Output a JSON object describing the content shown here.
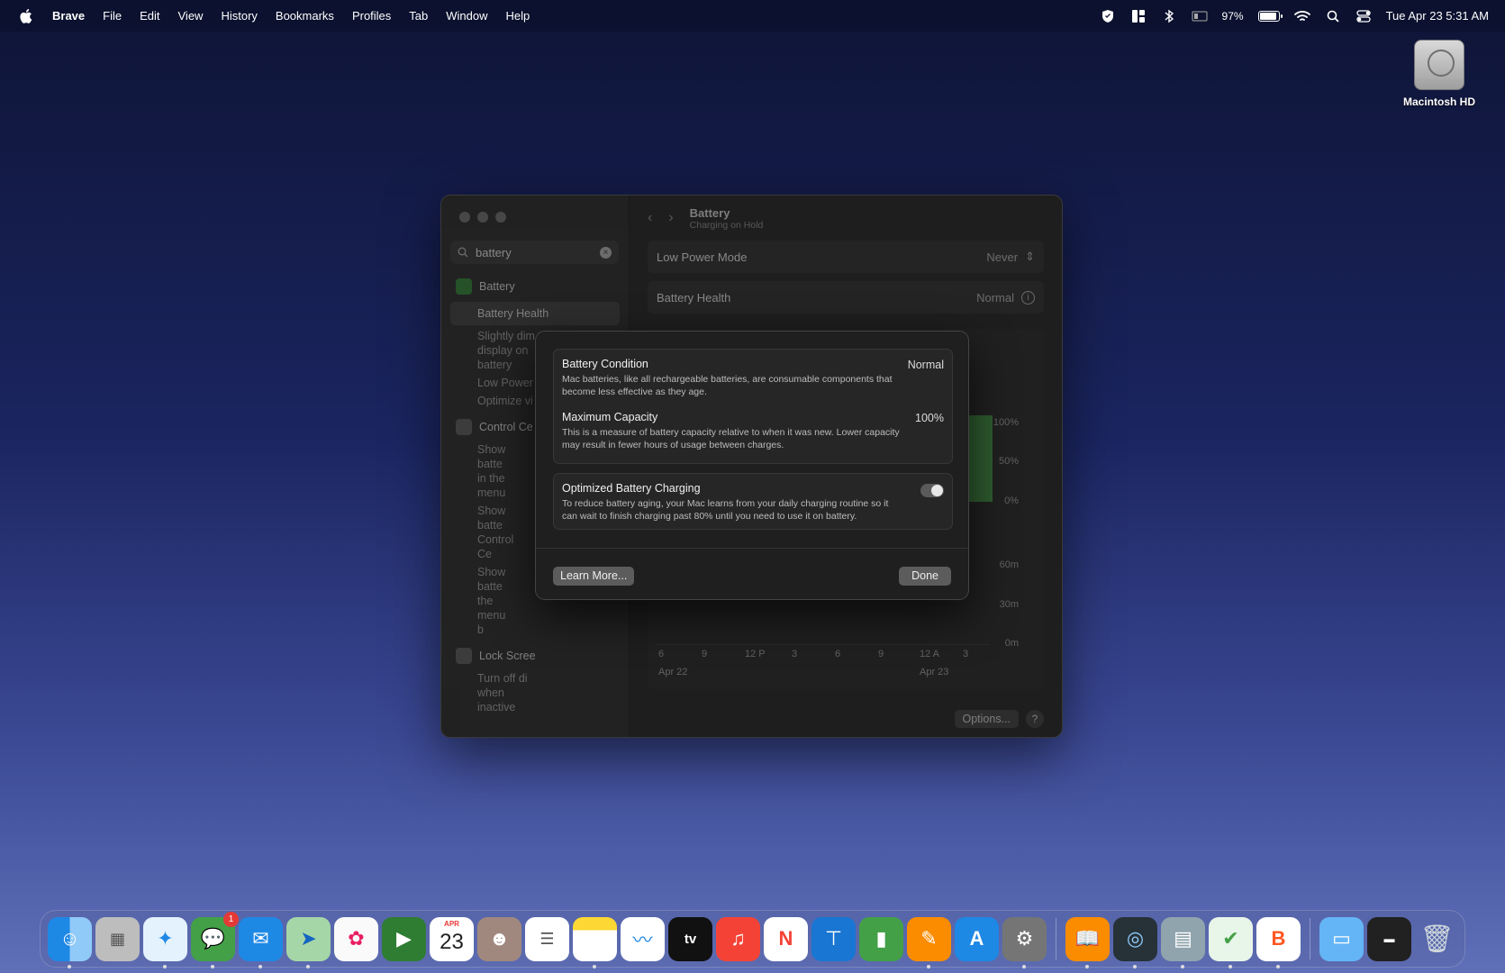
{
  "menubar": {
    "apple": "",
    "app_name": "Brave",
    "menus": [
      "File",
      "Edit",
      "View",
      "History",
      "Bookmarks",
      "Profiles",
      "Tab",
      "Window",
      "Help"
    ],
    "battery_percent": "97%",
    "datetime": "Tue Apr 23  5:31 AM",
    "battery_level": 0.97
  },
  "desktop": {
    "drive_label": "Macintosh HD"
  },
  "settings": {
    "search_value": "battery",
    "sidebar": {
      "battery_group": "Battery",
      "battery_items": [
        "Battery Health",
        "Slightly dim the display on battery",
        "Low Power",
        "Optimize vi"
      ],
      "control_group": "Control Ce",
      "control_items": [
        "Show batte in the menu",
        "Show batte Control Ce",
        "Show batte the menu b"
      ],
      "lock_group": "Lock Scree",
      "lock_items": [
        "Turn off di when inactive"
      ]
    },
    "header": {
      "title": "Battery",
      "subtitle": "Charging on Hold"
    },
    "low_power": {
      "label": "Low Power Mode",
      "value": "Never"
    },
    "health": {
      "label": "Battery Health",
      "value": "Normal"
    },
    "chart": {
      "y_top": [
        "100%",
        "50%",
        "0%"
      ],
      "y_bottom": [
        "60m",
        "30m",
        "0m"
      ],
      "x_ticks": [
        "6",
        "9",
        "12 P",
        "3",
        "6",
        "9",
        "12 A",
        "3"
      ],
      "x_dates": [
        "Apr 22",
        "Apr 23"
      ]
    },
    "options_label": "Options...",
    "help_label": "?"
  },
  "sheet": {
    "condition": {
      "title": "Battery Condition",
      "value": "Normal",
      "desc": "Mac batteries, like all rechargeable batteries, are consumable components that become less effective as they age."
    },
    "capacity": {
      "title": "Maximum Capacity",
      "value": "100%",
      "desc": "This is a measure of battery capacity relative to when it was new. Lower capacity may result in fewer hours of usage between charges."
    },
    "optimized": {
      "title": "Optimized Battery Charging",
      "desc": "To reduce battery aging, your Mac learns from your daily charging routine so it can wait to finish charging past 80% until you need to use it on battery.",
      "enabled": true
    },
    "learn_more": "Learn More...",
    "done": "Done"
  },
  "dock": {
    "calendar_month": "APR",
    "calendar_day": "23",
    "messages_badge": "1",
    "apps_text": {
      "tv": "tv"
    }
  }
}
